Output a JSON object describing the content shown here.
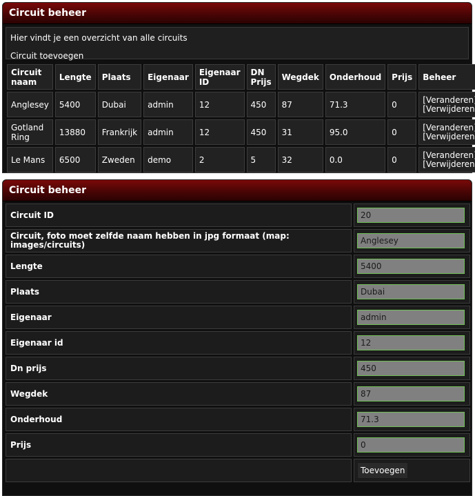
{
  "list_panel": {
    "title": "Circuit beheer",
    "intro_text": "Hier vindt je een overzicht van alle circuits",
    "add_link": "Circuit toevoegen",
    "columns": [
      "Circuit naam",
      "Lengte",
      "Plaats",
      "Eigenaar",
      "Eigenaar ID",
      "DN Prijs",
      "Wegdek",
      "Onderhoud",
      "Prijs",
      "Beheer"
    ],
    "rows": [
      {
        "naam": "Anglesey",
        "lengte": "5400",
        "plaats": "Dubai",
        "eigenaar": "admin",
        "eigenaar_id": "12",
        "dn_prijs": "450",
        "wegdek": "87",
        "onderhoud": "71.3",
        "prijs": "0",
        "edit": "[Veranderen]",
        "delete": "[Verwijderen]"
      },
      {
        "naam": "Gotland Ring",
        "lengte": "13880",
        "plaats": "Frankrijk",
        "eigenaar": "admin",
        "eigenaar_id": "12",
        "dn_prijs": "450",
        "wegdek": "31",
        "onderhoud": "95.0",
        "prijs": "0",
        "edit": "[Veranderen]",
        "delete": "[Verwijderen]"
      },
      {
        "naam": "Le Mans",
        "lengte": "6500",
        "plaats": "Zweden",
        "eigenaar": "demo",
        "eigenaar_id": "2",
        "dn_prijs": "5",
        "wegdek": "32",
        "onderhoud": "0.0",
        "prijs": "0",
        "edit": "[Veranderen]",
        "delete": "[Verwijderen]"
      }
    ]
  },
  "form_panel": {
    "title": "Circuit beheer",
    "fields": [
      {
        "label": "Circuit ID",
        "value": "20"
      },
      {
        "label": "Circuit, foto moet zelfde naam hebben in jpg formaat (map: images/circuits)",
        "value": "Anglesey"
      },
      {
        "label": "Lengte",
        "value": "5400"
      },
      {
        "label": "Plaats",
        "value": "Dubai"
      },
      {
        "label": "Eigenaar",
        "value": "admin"
      },
      {
        "label": "Eigenaar id",
        "value": "12"
      },
      {
        "label": "Dn prijs",
        "value": "450"
      },
      {
        "label": "Wegdek",
        "value": "87"
      },
      {
        "label": "Onderhoud",
        "value": "71.3"
      },
      {
        "label": "Prijs",
        "value": "0"
      }
    ],
    "submit_label": "Toevoegen"
  },
  "colors": {
    "header_red": "#6a0707",
    "panel_bg": "#0f0f0f",
    "cell_bg": "#222222",
    "input_bg": "#808080",
    "input_border": "#6fbf55"
  }
}
